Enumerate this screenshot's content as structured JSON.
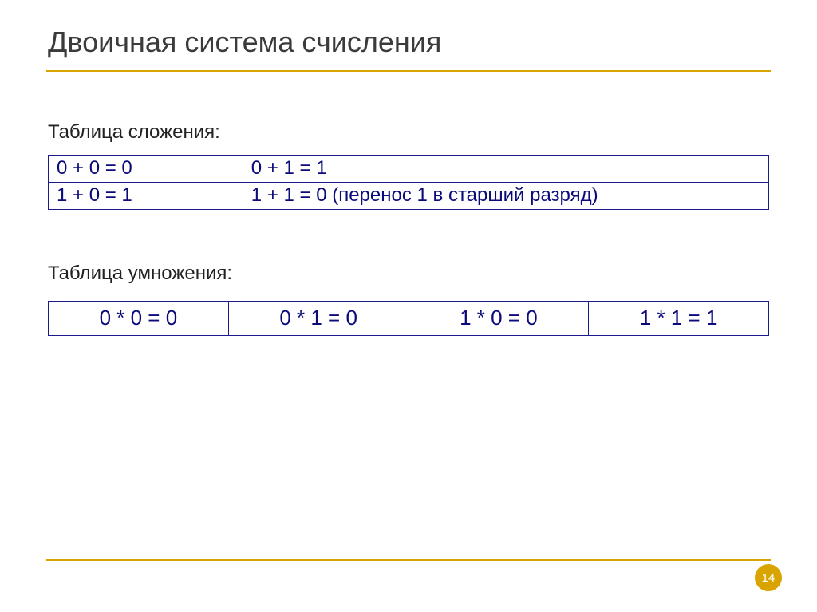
{
  "title": "Двоичная система счисления",
  "addition": {
    "label": "Таблица сложения:",
    "rows": [
      [
        "0 + 0 = 0",
        "0 + 1 = 1"
      ],
      [
        "1 + 0 = 1",
        "1 + 1 = 0 (перенос 1 в старший разряд)"
      ]
    ]
  },
  "multiplication": {
    "label": "Таблица умножения:",
    "cells": [
      "0 * 0 = 0",
      "0 * 1 = 0",
      "1 * 0 = 0",
      "1 * 1 = 1"
    ]
  },
  "page_number": "14",
  "colors": {
    "accent": "#d9a300",
    "table_text": "#0a0a7a",
    "table_border": "#1a1a8a"
  }
}
